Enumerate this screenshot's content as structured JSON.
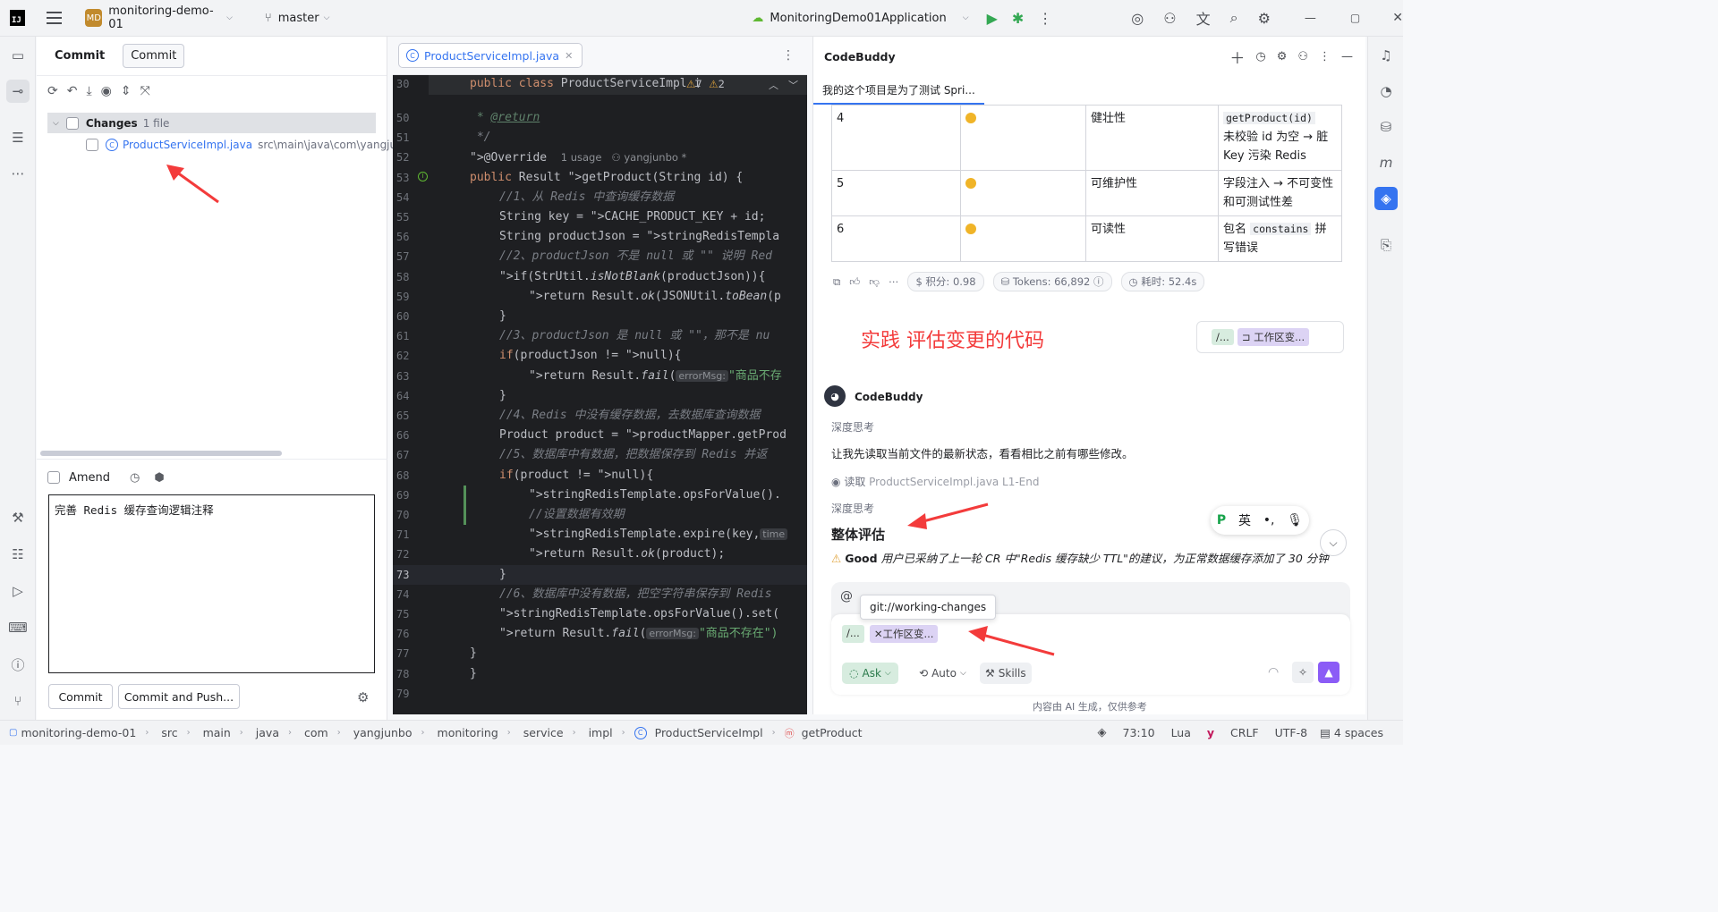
{
  "titlebar": {
    "project_badge": "MD",
    "project_name": "monitoring-demo-01",
    "branch": "master",
    "run_config": "MonitoringDemo01Application"
  },
  "commit_panel": {
    "tab_commit_title": "Commit",
    "tab_commit_button": "Commit",
    "changes_label": "Changes",
    "changes_count": "1 file",
    "file_name": "ProductServiceImpl.java",
    "file_path": "src\\main\\java\\com\\yangjunb",
    "amend_label": "Amend",
    "message": "完善 Redis 缓存查询逻辑注释",
    "commit_button": "Commit",
    "commit_push_button": "Commit and Push..."
  },
  "editor": {
    "tab_name": "ProductServiceImpl.java",
    "sticky_line_no": "30",
    "sticky_code": "public class ProductServiceImpl i",
    "warnings": "7",
    "weak_warnings": "2",
    "lines": [
      {
        "no": "50",
        "code": " * @return"
      },
      {
        "no": "51",
        "code": " */"
      },
      {
        "no": "52",
        "code": "@Override",
        "usage": "1 usage",
        "author": "yangjunbo *"
      },
      {
        "no": "53",
        "code": "public Result getProduct(String id) {"
      },
      {
        "no": "54",
        "code": "//1、从 Redis 中查询缓存数据"
      },
      {
        "no": "55",
        "code": "String key = CACHE_PRODUCT_KEY + id;"
      },
      {
        "no": "56",
        "code": "String productJson = stringRedisTempla"
      },
      {
        "no": "57",
        "code": "//2、productJson 不是 null 或 \"\" 说明 Red"
      },
      {
        "no": "58",
        "code": "if(StrUtil.isNotBlank(productJson)){"
      },
      {
        "no": "59",
        "code": "return Result.ok(JSONUtil.toBean(p"
      },
      {
        "no": "60",
        "code": "}"
      },
      {
        "no": "61",
        "code": "//3、productJson 是 null 或 \"\"，那不是 nu"
      },
      {
        "no": "62",
        "code": "if(productJson != null){"
      },
      {
        "no": "63",
        "code": "return Result.fail(",
        "hint": "errorMsg:",
        "rest": "\"商品不存"
      },
      {
        "no": "64",
        "code": "}"
      },
      {
        "no": "65",
        "code": "//4、Redis 中没有缓存数据，去数据库查询数据"
      },
      {
        "no": "66",
        "code": "Product product = productMapper.getProd"
      },
      {
        "no": "67",
        "code": "//5、数据库中有数据，把数据保存到 Redis 并返"
      },
      {
        "no": "68",
        "code": "if(product != null){"
      },
      {
        "no": "69",
        "code": "stringRedisTemplate.opsForValue()."
      },
      {
        "no": "70",
        "code": "//设置数据有效期"
      },
      {
        "no": "71",
        "code": "stringRedisTemplate.expire(key,",
        "hint": "time"
      },
      {
        "no": "72",
        "code": "return Result.ok(product);"
      },
      {
        "no": "73",
        "code": "}"
      },
      {
        "no": "74",
        "code": "//6、数据库中没有数据，把空字符串保存到 Redis"
      },
      {
        "no": "75",
        "code": "stringRedisTemplate.opsForValue().set("
      },
      {
        "no": "76",
        "code": "return Result.fail(",
        "hint": "errorMsg:",
        "rest": "\"商品不存在\")"
      },
      {
        "no": "77",
        "code": "}"
      },
      {
        "no": "78",
        "code": "}"
      },
      {
        "no": "79",
        "code": ""
      }
    ]
  },
  "codebuddy": {
    "title": "CodeBuddy",
    "session_tab": "我的这个项目是为了测试 Spri...",
    "table_rows": [
      {
        "idx": "4",
        "category": "健壮性",
        "code": "getProduct(id)",
        "desc": "未校验 id 为空 → 脏 Key 污染 Redis"
      },
      {
        "idx": "5",
        "category": "可维护性",
        "desc": "字段注入 → 不可变性和可测试性差"
      },
      {
        "idx": "6",
        "category": "可读性",
        "desc_pre": "包名",
        "code": "constains",
        "desc_post": "拼写错误"
      }
    ],
    "meta": {
      "points": "积分: 0.98",
      "tokens": "Tokens: 66,892",
      "time": "耗时: 52.4s"
    },
    "annotation": "实践 评估变更的代码",
    "user_chip1": "/...",
    "user_chip2": "工作区变...",
    "reply_name": "CodeBuddy",
    "deep_think_1": "深度思考",
    "reply_text": "让我先读取当前文件的最新状态，看看相比之前有哪些修改。",
    "read_label": "读取",
    "read_file": "ProductServiceImpl.java L1-End",
    "deep_think_2": "深度思考",
    "heading": "整体评估",
    "good_label": "Good",
    "good_text": "用户已采纳了上一轮 CR 中\"Redis 缓存缺少 TTL\"的建议，为正常数据缓存添加了 30 分钟",
    "ime_lang": "英",
    "tooltip": "git://working-changes",
    "input_chip1": "/...",
    "input_chip2": "工作区变...",
    "mode": "Ask",
    "model": "Auto",
    "skills": "Skills",
    "footer_note": "内容由 AI 生成，仅供参考"
  },
  "statusbar": {
    "crumbs": [
      "monitoring-demo-01",
      "src",
      "main",
      "java",
      "com",
      "yangjunbo",
      "monitoring",
      "service",
      "impl",
      "ProductServiceImpl",
      "getProduct"
    ],
    "position": "73:10",
    "lang": "Lua",
    "line_sep": "CRLF",
    "encoding": "UTF-8",
    "indent": "4 spaces"
  }
}
